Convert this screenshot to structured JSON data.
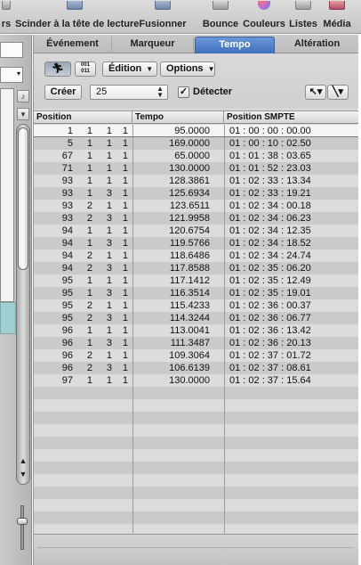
{
  "toolbar": {
    "items": [
      {
        "label": "rs",
        "icon": "toolbar-icon"
      },
      {
        "label": "Scinder à la tête de lecture",
        "icon": "split-icon"
      },
      {
        "label": "Fusionner",
        "icon": "merge-icon"
      },
      {
        "label": "Bounce",
        "icon": "bounce-icon"
      },
      {
        "label": "Couleurs",
        "icon": "colors-icon"
      },
      {
        "label": "Listes",
        "icon": "lists-icon"
      },
      {
        "label": "Média",
        "icon": "media-icon"
      }
    ]
  },
  "tabs": [
    {
      "label": "Événement",
      "active": false
    },
    {
      "label": "Marqueur",
      "active": false
    },
    {
      "label": "Tempo",
      "active": true
    },
    {
      "label": "Altération",
      "active": false
    }
  ],
  "controls": {
    "binary_label": "001\n011",
    "edit_menu": "Édition",
    "options_menu": "Options",
    "create_button": "Créer",
    "value_field": "25",
    "detect_label": "Détecter",
    "detect_checked": true
  },
  "columns": {
    "position": "Position",
    "tempo": "Tempo",
    "smpte": "Position SMPTE"
  },
  "rows": [
    {
      "bar": "1",
      "beat": "1",
      "div": "1",
      "tick": "1",
      "tempo": "95.0000",
      "smpte": "01 : 00 : 00 : 00.00",
      "selected": true
    },
    {
      "bar": "5",
      "beat": "1",
      "div": "1",
      "tick": "1",
      "tempo": "169.0000",
      "smpte": "01 : 00 : 10 : 02.50"
    },
    {
      "bar": "67",
      "beat": "1",
      "div": "1",
      "tick": "1",
      "tempo": "65.0000",
      "smpte": "01 : 01 : 38 : 03.65"
    },
    {
      "bar": "71",
      "beat": "1",
      "div": "1",
      "tick": "1",
      "tempo": "130.0000",
      "smpte": "01 : 01 : 52 : 23.03"
    },
    {
      "bar": "93",
      "beat": "1",
      "div": "1",
      "tick": "1",
      "tempo": "128.3861",
      "smpte": "01 : 02 : 33 : 13.34"
    },
    {
      "bar": "93",
      "beat": "1",
      "div": "3",
      "tick": "1",
      "tempo": "125.6934",
      "smpte": "01 : 02 : 33 : 19.21"
    },
    {
      "bar": "93",
      "beat": "2",
      "div": "1",
      "tick": "1",
      "tempo": "123.6511",
      "smpte": "01 : 02 : 34 : 00.18"
    },
    {
      "bar": "93",
      "beat": "2",
      "div": "3",
      "tick": "1",
      "tempo": "121.9958",
      "smpte": "01 : 02 : 34 : 06.23"
    },
    {
      "bar": "94",
      "beat": "1",
      "div": "1",
      "tick": "1",
      "tempo": "120.6754",
      "smpte": "01 : 02 : 34 : 12.35"
    },
    {
      "bar": "94",
      "beat": "1",
      "div": "3",
      "tick": "1",
      "tempo": "119.5766",
      "smpte": "01 : 02 : 34 : 18.52"
    },
    {
      "bar": "94",
      "beat": "2",
      "div": "1",
      "tick": "1",
      "tempo": "118.6486",
      "smpte": "01 : 02 : 34 : 24.74"
    },
    {
      "bar": "94",
      "beat": "2",
      "div": "3",
      "tick": "1",
      "tempo": "117.8588",
      "smpte": "01 : 02 : 35 : 06.20"
    },
    {
      "bar": "95",
      "beat": "1",
      "div": "1",
      "tick": "1",
      "tempo": "117.1412",
      "smpte": "01 : 02 : 35 : 12.49"
    },
    {
      "bar": "95",
      "beat": "1",
      "div": "3",
      "tick": "1",
      "tempo": "116.3514",
      "smpte": "01 : 02 : 35 : 19.01"
    },
    {
      "bar": "95",
      "beat": "2",
      "div": "1",
      "tick": "1",
      "tempo": "115.4233",
      "smpte": "01 : 02 : 36 : 00.37"
    },
    {
      "bar": "95",
      "beat": "2",
      "div": "3",
      "tick": "1",
      "tempo": "114.3244",
      "smpte": "01 : 02 : 36 : 06.77"
    },
    {
      "bar": "96",
      "beat": "1",
      "div": "1",
      "tick": "1",
      "tempo": "113.0041",
      "smpte": "01 : 02 : 36 : 13.42"
    },
    {
      "bar": "96",
      "beat": "1",
      "div": "3",
      "tick": "1",
      "tempo": "111.3487",
      "smpte": "01 : 02 : 36 : 20.13"
    },
    {
      "bar": "96",
      "beat": "2",
      "div": "1",
      "tick": "1",
      "tempo": "109.3064",
      "smpte": "01 : 02 : 37 : 01.72"
    },
    {
      "bar": "96",
      "beat": "2",
      "div": "3",
      "tick": "1",
      "tempo": "106.6139",
      "smpte": "01 : 02 : 37 : 08.61"
    },
    {
      "bar": "97",
      "beat": "1",
      "div": "1",
      "tick": "1",
      "tempo": "130.0000",
      "smpte": "01 : 02 : 37 : 15.64"
    }
  ]
}
